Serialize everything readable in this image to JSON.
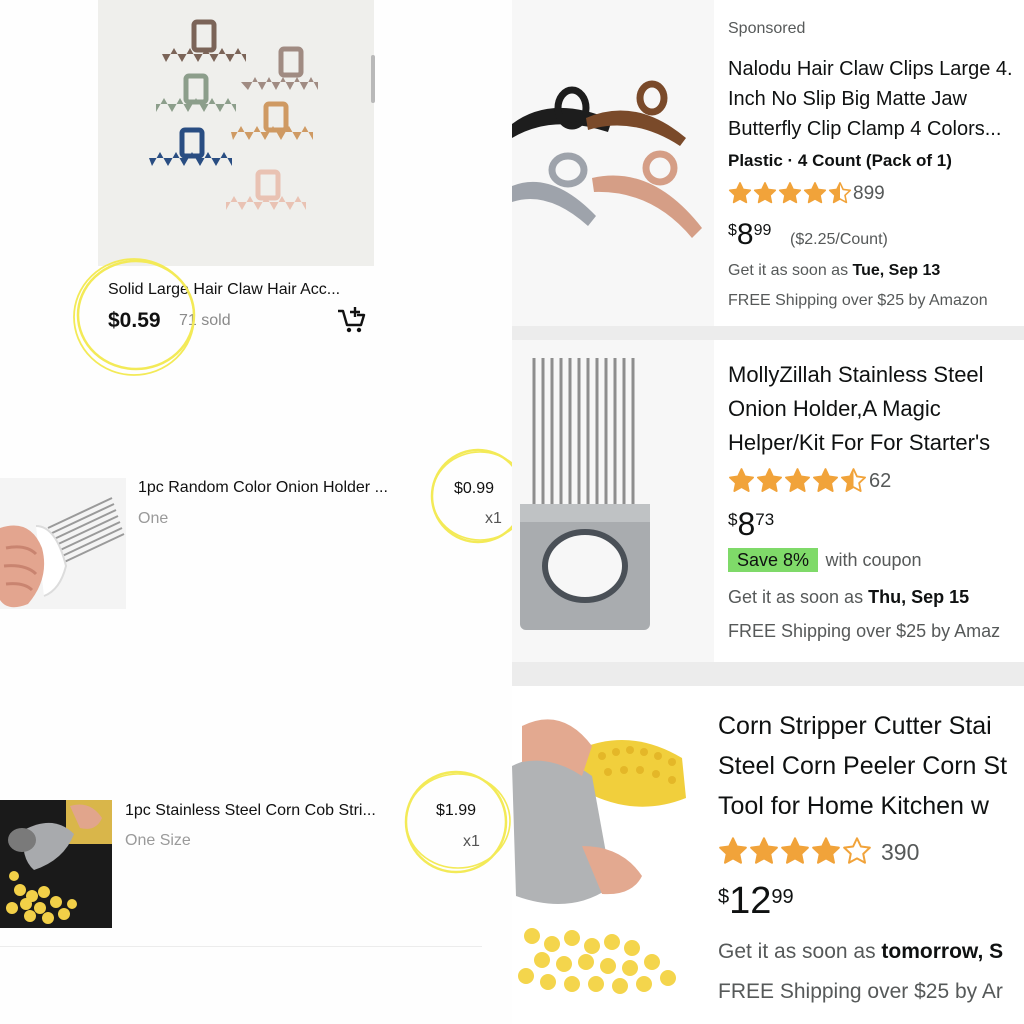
{
  "left": {
    "items": [
      {
        "title": "Solid Large Hair Claw Hair Acc...",
        "price": "$0.59",
        "sold": "71 sold"
      },
      {
        "title": "1pc Random Color Onion Holder ...",
        "variant": "One",
        "price": "$0.99",
        "qty": "x1"
      },
      {
        "title": "1pc Stainless Steel Corn Cob Stri...",
        "variant": "One Size",
        "price": "$1.99",
        "qty": "x1"
      }
    ],
    "cart_icon": "add-to-cart-icon",
    "highlight_color": "#f3ea57"
  },
  "right": {
    "items": [
      {
        "badge": "Sponsored",
        "title_lines": [
          "Nalodu Hair Claw Clips Large 4.",
          "Inch No Slip Big Matte Jaw",
          "Butterfly Clip Clamp 4 Colors..."
        ],
        "attrs": "Plastic · 4 Count (Pack of 1)",
        "rating": 4.5,
        "reviews": "899",
        "price_symbol": "$",
        "price_whole": "8",
        "price_cents": "99",
        "unit_price": "($2.25/Count)",
        "delivery_prefix": "Get it as soon as ",
        "delivery_date": "Tue, Sep 13",
        "shipping": "FREE Shipping over $25 by Amazon"
      },
      {
        "title_lines": [
          "MollyZillah Stainless Steel",
          "Onion Holder,A Magic",
          "Helper/Kit For For Starter's"
        ],
        "rating": 4.5,
        "reviews": "62",
        "price_symbol": "$",
        "price_whole": "8",
        "price_cents": "73",
        "coupon": "Save 8%",
        "coupon_suffix": "with coupon",
        "delivery_prefix": "Get it as soon as ",
        "delivery_date": "Thu, Sep 15",
        "shipping": "FREE Shipping over $25 by Amaz"
      },
      {
        "title_lines": [
          "Corn Stripper Cutter Stai",
          "Steel Corn Peeler Corn St",
          "Tool for Home Kitchen w"
        ],
        "rating": 4,
        "reviews": "390",
        "price_symbol": "$",
        "price_whole": "12",
        "price_cents": "99",
        "delivery_prefix": "Get it as soon as ",
        "delivery_date": "tomorrow, S",
        "shipping": "FREE Shipping over $25 by Ar"
      }
    ],
    "star_color": "#f1a33a",
    "coupon_color": "#7fda69"
  }
}
